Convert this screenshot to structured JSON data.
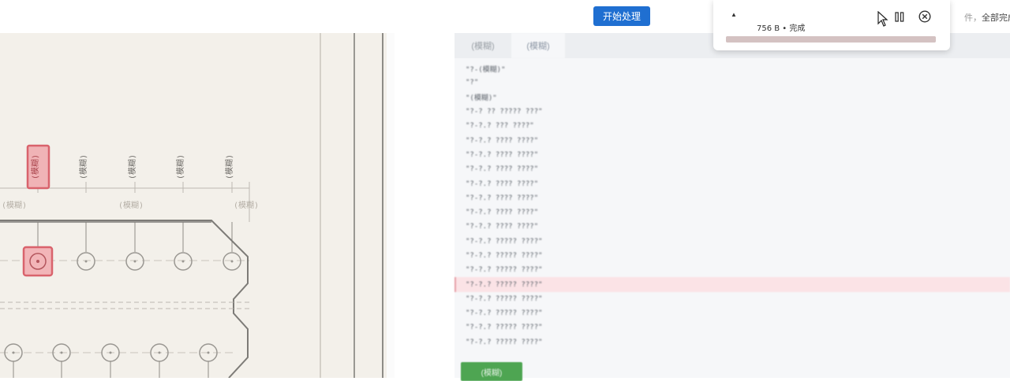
{
  "toolbar": {
    "start_button_label": "开始处理",
    "status_prefix": "件，",
    "status_done": "全部完成"
  },
  "download": {
    "size_label": "756 B • 完成",
    "progress": 1.0
  },
  "tabs": [
    {
      "label": "(模糊)"
    },
    {
      "label": "(模糊)"
    }
  ],
  "code_lines": [
    "\"?-(模糊)\"",
    "\"?\"",
    "\"(模糊)\"",
    "\"?-? ?? ????? ???\"",
    "\"?-?.? ??? ????\"",
    "\"?-?.? ???? ????\"",
    "\"?-?.? ???? ????\"",
    "\"?-?.? ???? ????\"",
    "\"?-?.? ???? ????\"",
    "\"?-?.? ???? ????\"",
    "\"?-?.? ???? ????\"",
    "\"?-?.? ???? ????\"",
    "\"?-?.? ????? ????\"",
    "\"?-?.? ????? ????\"",
    "\"?-?.? ????? ????\"",
    "\"?-?.? ????? ????\"",
    "\"?-?.? ????? ????\"",
    "\"?-?.? ????? ????\"",
    "\"?-?.? ????? ????\"",
    "\"?-?.? ????? ????\""
  ],
  "highlighted_line_index": 15,
  "copy_button_label": "(模糊)",
  "drawing": {
    "column_labels": [
      "(模糊)",
      "(模糊)",
      "(模糊)",
      "(模糊)",
      "(模糊)"
    ],
    "axis_labels": [
      "(模糊)",
      "(模糊)",
      "(模糊)"
    ]
  },
  "colors": {
    "primary": "#1f6fd1",
    "highlight": "#e05a66",
    "copy_button": "#4ea552"
  }
}
